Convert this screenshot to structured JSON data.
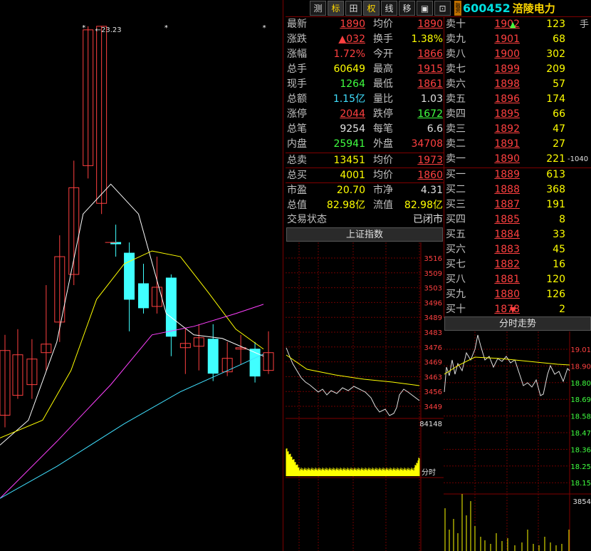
{
  "toolbar": {
    "buttons": [
      {
        "name": "tb-ce",
        "label": "测",
        "active": false
      },
      {
        "name": "tb-biao",
        "label": "标",
        "active": true
      },
      {
        "name": "tb-grid",
        "label": "田",
        "active": false
      },
      {
        "name": "tb-quan",
        "label": "权",
        "active": true
      },
      {
        "name": "tb-xian",
        "label": "线",
        "active": false
      },
      {
        "name": "tb-yi",
        "label": "移",
        "active": false
      },
      {
        "name": "tb-box",
        "label": "▣",
        "active": false
      },
      {
        "name": "tb-f10",
        "label": "⊡",
        "active": false
      }
    ],
    "badge": "融资",
    "code": "600452",
    "name": "涪陵电力"
  },
  "kline": {
    "max_label": "23.23",
    "colors": {
      "up": "#ff4040",
      "down": "#40ffff",
      "ma5": "#ffffff",
      "ma10": "#ffff00",
      "ma20": "#ff40ff",
      "ma60": "#40e0ff"
    }
  },
  "quote": {
    "left": [
      {
        "label": "最新",
        "value": "1890",
        "cls": "red ul"
      },
      {
        "label": "涨跌",
        "value": "▲032",
        "cls": "red ul"
      },
      {
        "label": "涨幅",
        "value": "1.72%",
        "cls": "red"
      },
      {
        "label": "总手",
        "value": "60649",
        "cls": "yellow"
      },
      {
        "label": "现手",
        "value": "1264",
        "cls": "green"
      },
      {
        "label": "总额",
        "value": "1.15亿",
        "cls": "cyan"
      },
      {
        "label": "涨停",
        "value": "2044",
        "cls": "red ul"
      },
      {
        "label": "总笔",
        "value": "9254",
        "cls": "white"
      },
      {
        "label": "内盘",
        "value": "25941",
        "cls": "green"
      },
      {
        "label": "总卖",
        "value": "13451",
        "cls": "yellow"
      },
      {
        "label": "总买",
        "value": "4001",
        "cls": "yellow"
      },
      {
        "label": "市盈",
        "value": "20.70",
        "cls": "yellow"
      },
      {
        "label": "总值",
        "value": "82.98亿",
        "cls": "yellow"
      }
    ],
    "right": [
      {
        "label": "均价",
        "value": "1890",
        "cls": "red ul"
      },
      {
        "label": "换手",
        "value": "1.38%",
        "cls": "yellow"
      },
      {
        "label": "今开",
        "value": "1866",
        "cls": "red ul"
      },
      {
        "label": "最高",
        "value": "1915",
        "cls": "red ul"
      },
      {
        "label": "最低",
        "value": "1861",
        "cls": "red ul"
      },
      {
        "label": "量比",
        "value": "1.03",
        "cls": "white"
      },
      {
        "label": "跌停",
        "value": "1672",
        "cls": "green ul"
      },
      {
        "label": "每笔",
        "value": "6.6",
        "cls": "white"
      },
      {
        "label": "外盘",
        "value": "34708",
        "cls": "red"
      },
      {
        "label": "均价",
        "value": "1973",
        "cls": "red ul"
      },
      {
        "label": "均价",
        "value": "1860",
        "cls": "red ul"
      },
      {
        "label": "市净",
        "value": "4.31",
        "cls": "white"
      },
      {
        "label": "流值",
        "value": "82.98亿",
        "cls": "yellow"
      }
    ],
    "status_label": "交易状态",
    "status_value": "已闭市"
  },
  "orderbook": {
    "unit": "手",
    "sells": [
      {
        "label": "卖十",
        "price": "1902",
        "vol": "123",
        "arrow": "up"
      },
      {
        "label": "卖九",
        "price": "1901",
        "vol": "68"
      },
      {
        "label": "卖八",
        "price": "1900",
        "vol": "302"
      },
      {
        "label": "卖七",
        "price": "1899",
        "vol": "209"
      },
      {
        "label": "卖六",
        "price": "1898",
        "vol": "57"
      },
      {
        "label": "卖五",
        "price": "1896",
        "vol": "174"
      },
      {
        "label": "卖四",
        "price": "1895",
        "vol": "66"
      },
      {
        "label": "卖三",
        "price": "1892",
        "vol": "47"
      },
      {
        "label": "卖二",
        "price": "1891",
        "vol": "27"
      },
      {
        "label": "卖一",
        "price": "1890",
        "vol": "221",
        "ext": "-1040"
      }
    ],
    "buys": [
      {
        "label": "买一",
        "price": "1889",
        "vol": "613"
      },
      {
        "label": "买二",
        "price": "1888",
        "vol": "368"
      },
      {
        "label": "买三",
        "price": "1887",
        "vol": "191"
      },
      {
        "label": "买四",
        "price": "1885",
        "vol": "8"
      },
      {
        "label": "买五",
        "price": "1884",
        "vol": "33"
      },
      {
        "label": "买六",
        "price": "1883",
        "vol": "45"
      },
      {
        "label": "买七",
        "price": "1882",
        "vol": "16"
      },
      {
        "label": "买八",
        "price": "1881",
        "vol": "120"
      },
      {
        "label": "买九",
        "price": "1880",
        "vol": "126"
      },
      {
        "label": "买十",
        "price": "1878",
        "vol": "2",
        "arrow": "down"
      }
    ]
  },
  "index_panel": {
    "title": "上证指数",
    "y_labels": [
      "3516",
      "3509",
      "3503",
      "3496",
      "3489",
      "3483",
      "3476",
      "3469",
      "3463",
      "3456",
      "3449"
    ],
    "volume_label": "84148",
    "time_label": "分时"
  },
  "intraday_panel": {
    "title": "分时走势",
    "y_labels": [
      "19.01",
      "18.90",
      "18.80",
      "18.69",
      "18.58",
      "18.47",
      "18.36",
      "18.25",
      "18.15"
    ],
    "volume_label": "3854"
  }
}
